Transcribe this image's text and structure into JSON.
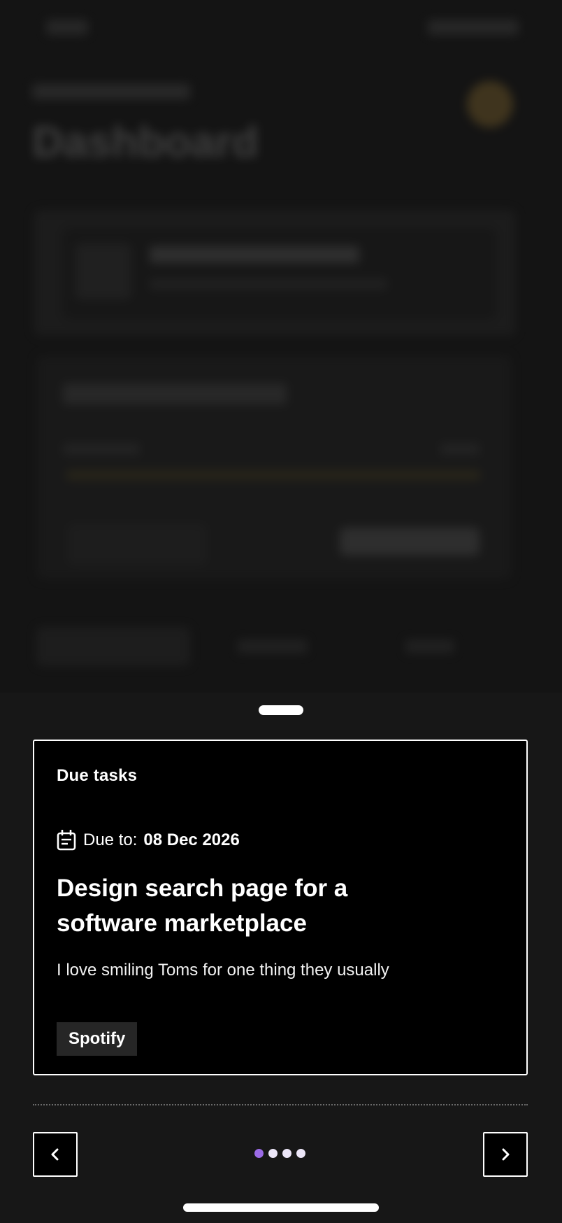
{
  "background": {
    "title": "Dashboard"
  },
  "task_card": {
    "heading": "Due tasks",
    "due_label": "Due to:",
    "due_date": "08 Dec 2026",
    "title": "Design search page for a software marketplace",
    "description": "I love smiling Toms for one thing they usually",
    "tag": "Spotify"
  },
  "pager": {
    "total_pages": 4,
    "current_page": 1,
    "active_dot_color": "#9b6be6",
    "inactive_dot_color": "#ece6f8"
  },
  "icons": {
    "calendar": "calendar-icon",
    "prev": "chevron-left-icon",
    "next": "chevron-right-icon"
  }
}
